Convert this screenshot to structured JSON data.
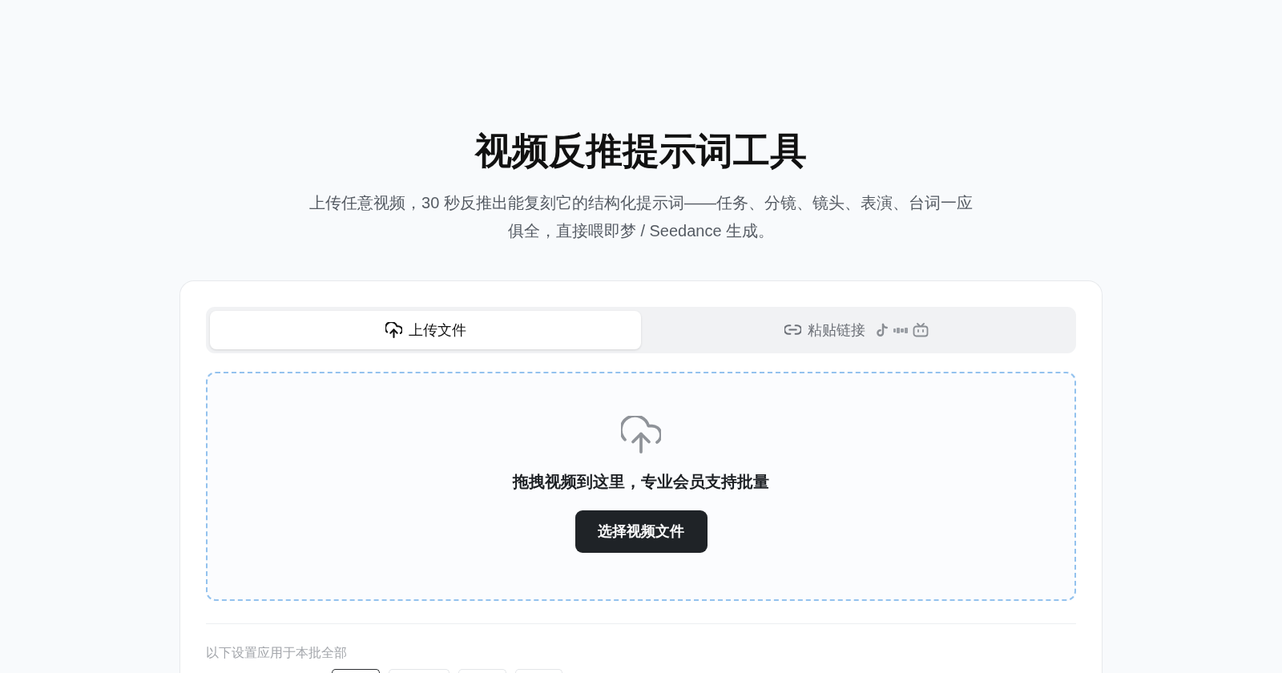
{
  "header": {
    "title": "视频反推提示词工具",
    "subtitle": "上传任意视频，30 秒反推出能复刻它的结构化提示词——任务、分镜、镜头、表演、台词一应俱全，直接喂即梦 / Seedance 生成。"
  },
  "tabs": [
    {
      "kind": "upload",
      "label": "上传文件",
      "selected": true
    },
    {
      "kind": "link",
      "label": "粘贴链接",
      "selected": false
    }
  ],
  "dropzone": {
    "prompt": "拖拽视频到这里，专业会员支持批量",
    "button": "选择视频文件"
  },
  "batch_settings": {
    "note": "以下设置应用于本批全部",
    "options": [
      {
        "selected": true
      },
      {
        "selected": false
      },
      {
        "selected": false
      },
      {
        "selected": false
      }
    ]
  }
}
